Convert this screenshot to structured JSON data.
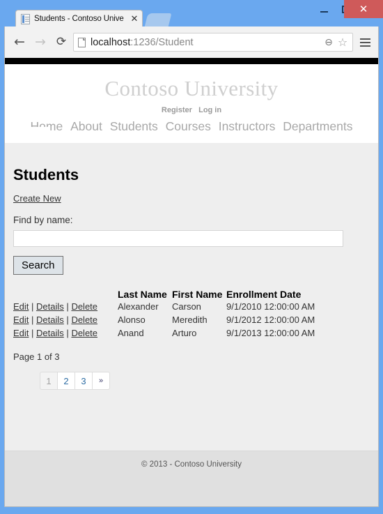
{
  "window": {
    "minimize_label": "–",
    "maximize_label": "",
    "close_label": "✕"
  },
  "browser": {
    "tab": {
      "title": "Students - Contoso Unive",
      "favicon": "page-icon",
      "close_label": "✕"
    },
    "new_tab_label": "",
    "back_label": "←",
    "forward_label": "→",
    "reload_label": "⟳",
    "url_host": "localhost",
    "url_path": ":1236/Student",
    "zoom_out_label": "⊖",
    "bookmark_label": "☆",
    "menu_label": "menu-icon"
  },
  "site": {
    "brand": "Contoso University",
    "auth_links": [
      {
        "label": "Register"
      },
      {
        "label": "Log in"
      }
    ],
    "nav_items": [
      {
        "label": "Home"
      },
      {
        "label": "About"
      },
      {
        "label": "Students"
      },
      {
        "label": "Courses"
      },
      {
        "label": "Instructors"
      },
      {
        "label": "Departments"
      }
    ],
    "footer": "© 2013 - Contoso University"
  },
  "main": {
    "page_title": "Students",
    "create_new_label": "Create New",
    "find_by_name_label": "Find by name:",
    "search_input_value": "",
    "search_input_placeholder": "",
    "search_button_label": "Search",
    "table": {
      "headers": {
        "actions": "",
        "last_name": "Last Name",
        "first_name": "First Name",
        "enrollment_date": "Enrollment Date"
      },
      "row_actions": {
        "edit": "Edit",
        "details": "Details",
        "delete": "Delete",
        "separator": "|"
      },
      "rows": [
        {
          "last_name": "Alexander",
          "first_name": "Carson",
          "enrollment_date": "9/1/2010 12:00:00 AM"
        },
        {
          "last_name": "Alonso",
          "first_name": "Meredith",
          "enrollment_date": "9/1/2012 12:00:00 AM"
        },
        {
          "last_name": "Anand",
          "first_name": "Arturo",
          "enrollment_date": "9/1/2013 12:00:00 AM"
        }
      ]
    },
    "page_counter": "Page 1 of 3",
    "pagination": [
      {
        "label": "1",
        "state": "disabled"
      },
      {
        "label": "2",
        "state": "enabled"
      },
      {
        "label": "3",
        "state": "enabled"
      },
      {
        "label": "»",
        "state": "next"
      }
    ]
  },
  "colors": {
    "window_chrome": "#6aa8ef",
    "close_button": "#cf5a5a",
    "page_background": "#eeeeee",
    "footer_background": "#e0e0e0",
    "brand_text": "#cfcfcf",
    "nav_text": "#a8a8a8"
  }
}
